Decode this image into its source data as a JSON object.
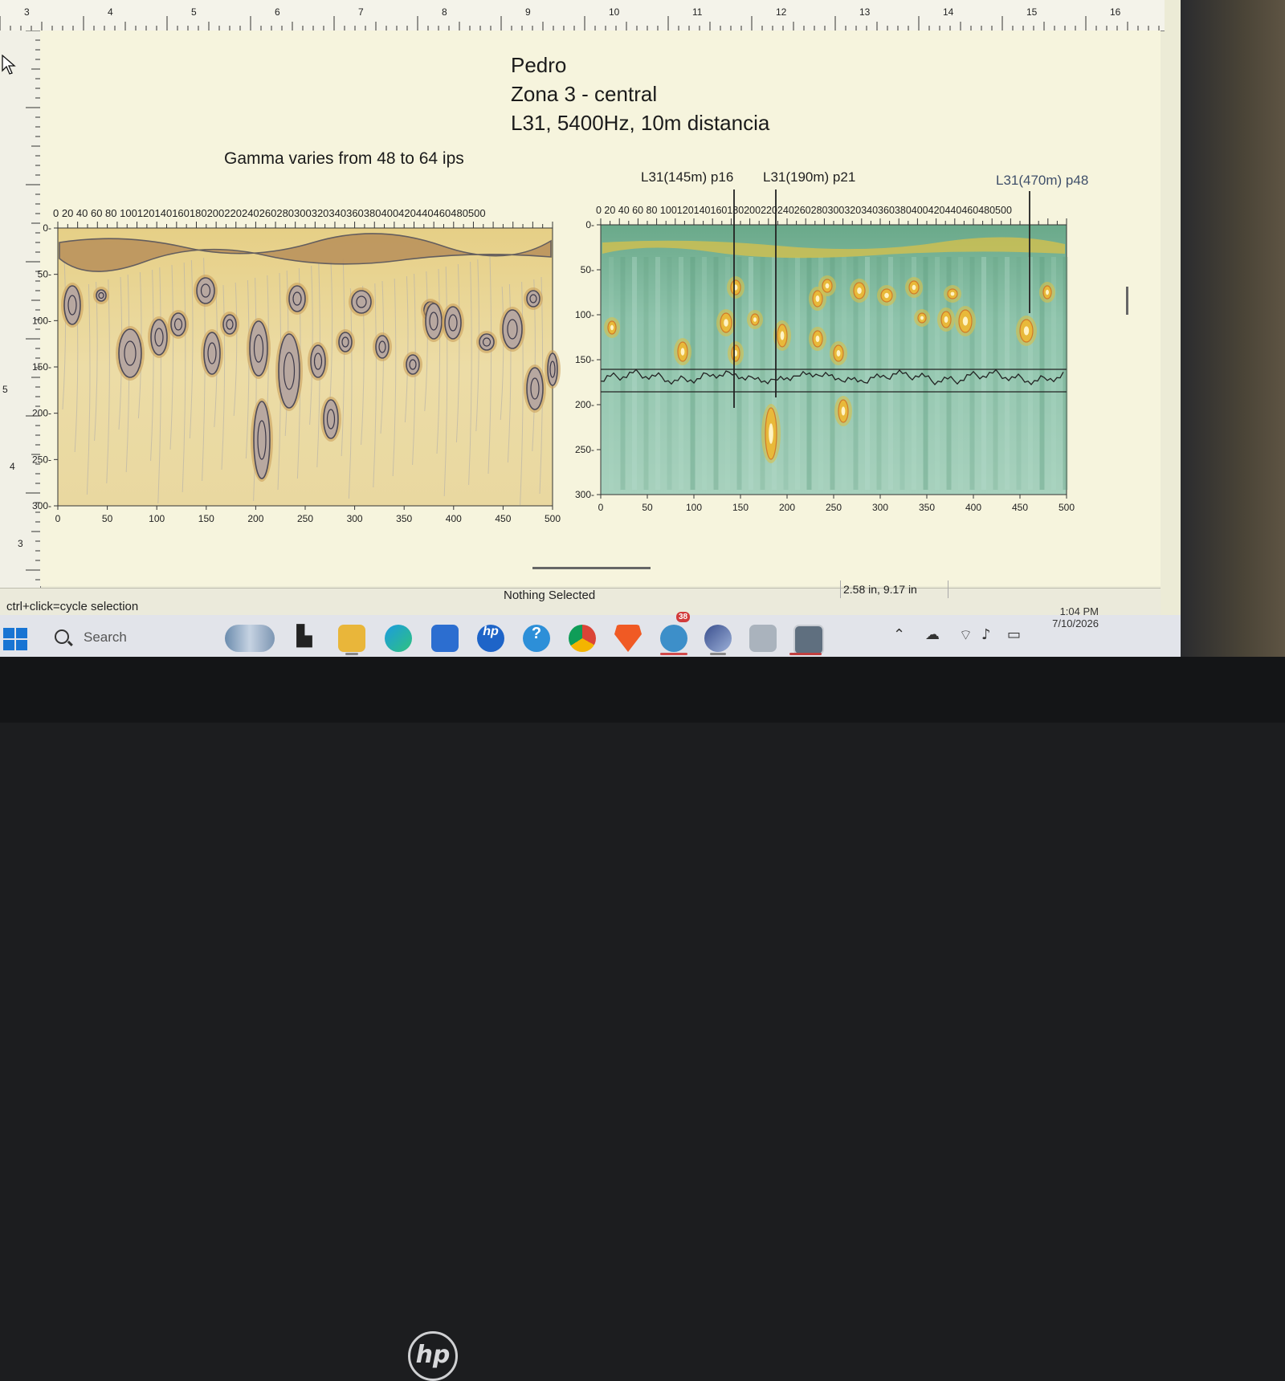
{
  "ruler": {
    "top_numbers": [
      "3",
      "4",
      "5",
      "6",
      "7",
      "8",
      "9",
      "10",
      "11",
      "12",
      "13",
      "14",
      "15",
      "16"
    ],
    "left_numbers": [
      "5",
      "4",
      "3"
    ]
  },
  "document": {
    "title_lines": [
      "Pedro",
      "Zona 3 - central",
      "L31, 5400Hz, 10m distancia"
    ],
    "gamma_note": "Gamma varies from 48 to 64 ips",
    "marker_labels": [
      "L31(145m) p16",
      "L31(190m) p21",
      "L31(470m) p48"
    ]
  },
  "left_plot": {
    "top_axis_text": "0  20  40  60  80 100120140160180200220240260280300320340360380400420440460480500",
    "y_ticks": [
      "0",
      "50",
      "100",
      "150",
      "200",
      "250",
      "300"
    ],
    "x_ticks": [
      "0",
      "50",
      "100",
      "150",
      "200",
      "250",
      "300",
      "350",
      "400",
      "450",
      "500"
    ],
    "colors": {
      "background": "#ead89a",
      "contour": "#4d4a57",
      "anomaly": "#c99a55"
    }
  },
  "right_plot": {
    "top_axis_text": "0  20  40  60  80 100120140160180200220240260280300320340360380400420440460480500",
    "y_ticks": [
      "0",
      "50",
      "100",
      "150",
      "200",
      "250",
      "300"
    ],
    "x_ticks": [
      "0",
      "50",
      "100",
      "150",
      "200",
      "250",
      "300",
      "350",
      "400",
      "450",
      "500"
    ],
    "colors": {
      "background": "#8fc4ad",
      "band": "#d9c24a",
      "anomaly": "#e8b93a"
    }
  },
  "status": {
    "left_hint": "ctrl+click=cycle selection",
    "selection": "Nothing Selected",
    "coords": "2.58 in, 9.17 in"
  },
  "taskbar": {
    "search_placeholder": "Search",
    "time": "1:04 PM",
    "date": "7/10/2026",
    "icons": [
      "windows-start-icon",
      "search-icon",
      "weather-widget-icon",
      "task-view-icon",
      "file-explorer-icon",
      "edge-icon",
      "microsoft-store-icon",
      "hp-icon",
      "help-icon",
      "chrome-icon",
      "brave-icon",
      "app-icon-badge",
      "app-icon-globe",
      "app-icon-tool",
      "app-icon-window"
    ],
    "badge": "38"
  }
}
